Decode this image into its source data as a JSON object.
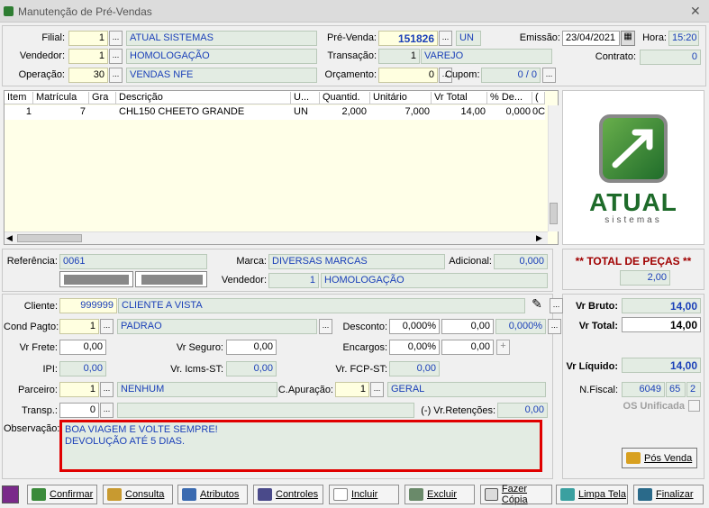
{
  "window": {
    "title": "Manutenção de Pré-Vendas"
  },
  "header": {
    "filial_label": "Filial:",
    "filial_code": "1",
    "filial_name": "ATUAL SISTEMAS",
    "vendedor_label": "Vendedor:",
    "vendedor_code": "1",
    "vendedor_name": "HOMOLOGAÇÃO",
    "operacao_label": "Operação:",
    "operacao_code": "30",
    "operacao_name": "VENDAS NFE",
    "prevenda_label": "Pré-Venda:",
    "prevenda_value": "151826",
    "prevenda_unit": "UN",
    "transacao_label": "Transação:",
    "transacao_code": "1",
    "transacao_name": "VAREJO",
    "orcamento_label": "Orçamento:",
    "orcamento_value": "0",
    "cupom_label": "Cupom:",
    "cupom_value": "0 / 0",
    "emissao_label": "Emissão:",
    "emissao_value": "23/04/2021",
    "hora_label": "Hora:",
    "hora_value": "15:20",
    "contrato_label": "Contrato:",
    "contrato_value": "0"
  },
  "grid": {
    "columns": [
      "Item",
      "Matrícula",
      "Gra",
      "Descrição",
      "U...",
      "Quantid.",
      "Unitário",
      "Vr Total",
      "% De...",
      "("
    ],
    "rows": [
      [
        "1",
        "7",
        "",
        "CHL150 CHEETO GRANDE",
        "UN",
        "2,000",
        "7,000",
        "14,00",
        "0,000",
        "0C"
      ]
    ]
  },
  "logo": {
    "brand": "ATUAL",
    "sub": "sistemas"
  },
  "middle": {
    "referencia_label": "Referência:",
    "referencia_value": "0061",
    "marca_label": "Marca:",
    "marca_value": "DIVERSAS MARCAS",
    "adicional_label": "Adicional:",
    "adicional_value": "0,000",
    "vendedor2_label": "Vendedor:",
    "vendedor2_code": "1",
    "vendedor2_name": "HOMOLOGAÇÃO",
    "total_pecas_label": "** TOTAL DE PEÇAS **",
    "total_pecas_value": "2,00"
  },
  "bottom": {
    "cliente_label": "Cliente:",
    "cliente_code": "999999",
    "cliente_name": "CLIENTE A VISTA",
    "cond_label": "Cond Pagto:",
    "cond_code": "1",
    "cond_name": "PADRAO",
    "desconto_label": "Desconto:",
    "desconto_pct": "0,000%",
    "desconto_val": "0,00",
    "desconto_pct2": "0,000%",
    "vrfrete_label": "Vr Frete:",
    "vrfrete_value": "0,00",
    "vrseguro_label": "Vr Seguro:",
    "vrseguro_value": "0,00",
    "encargos_label": "Encargos:",
    "encargos_pct": "0,00%",
    "encargos_val": "0,00",
    "ipi_label": "IPI:",
    "ipi_value": "0,00",
    "icms_label": "Vr. Icms-ST:",
    "icms_value": "0,00",
    "fcp_label": "Vr. FCP-ST:",
    "fcp_value": "0,00",
    "parceiro_label": "Parceiro:",
    "parceiro_code": "1",
    "parceiro_name": "NENHUM",
    "capuracao_label": "C.Apuração:",
    "capuracao_code": "1",
    "capuracao_name": "GERAL",
    "transp_label": "Transp.:",
    "transp_code": "0",
    "retencoes_label": "(-) Vr.Retenções:",
    "retencoes_value": "0,00",
    "obs_label": "Observação:",
    "obs_line1": "BOA VIAGEM E VOLTE SEMPRE!",
    "obs_line2": "DEVOLUÇÃO ATÉ 5 DIAS.",
    "vrbruto_label": "Vr Bruto:",
    "vrbruto_value": "14,00",
    "vrtotal_label": "Vr Total:",
    "vrtotal_value": "14,00",
    "vrliquido_label": "Vr Líquido:",
    "vrliquido_value": "14,00",
    "nfiscal_label": "N.Fiscal:",
    "nfiscal_value": "6049",
    "nfiscal_serie": "65",
    "nfiscal_n": "2",
    "os_label": "OS Unificada",
    "posvenda_label": "Pós Venda"
  },
  "toolbar": {
    "confirmar": "Confirmar",
    "consulta": "Consulta",
    "atributos": "Atributos",
    "controles": "Controles",
    "incluir": "Incluir",
    "excluir": "Excluir",
    "fazer_copia": "Fazer Cópia",
    "limpa_tela": "Limpa Tela",
    "finalizar": "Finalizar"
  },
  "ellipsis": "..."
}
